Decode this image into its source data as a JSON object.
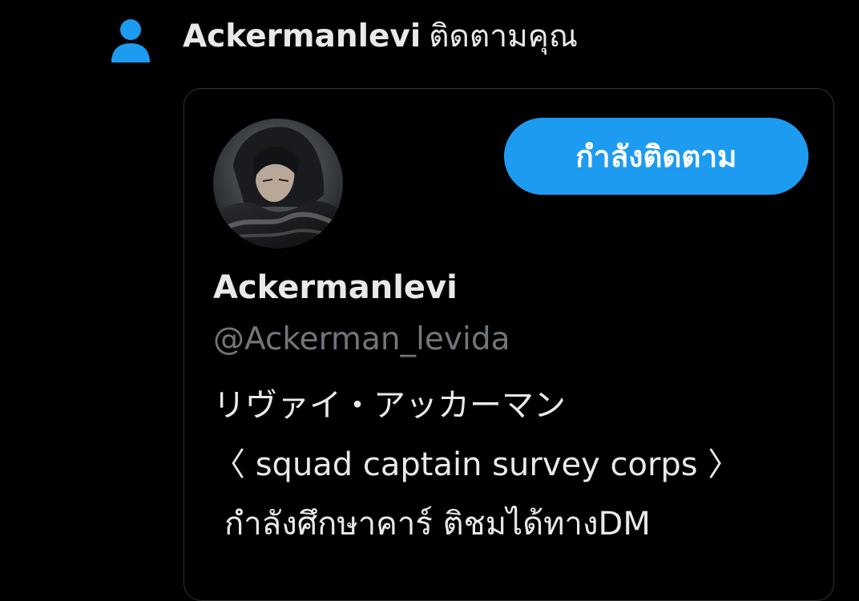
{
  "notification": {
    "icon": "person-icon",
    "name": "Ackermanlevi",
    "action": "ติดตามคุณ"
  },
  "card": {
    "avatar": "avatar",
    "follow_button": "กำลังติดตาม",
    "display_name": "Ackermanlevi",
    "handle": "@Ackerman_levida",
    "bio": [
      "リヴァイ・アッカーマン",
      "〈 squad captain survey corps 〉",
      "กำลังศึกษาคาร์ ติชมได้ทางDM"
    ]
  },
  "colors": {
    "background": "#000000",
    "accent": "#1d9bf0",
    "text": "#e7e9ea",
    "muted": "#71767b",
    "border": "#2f3336"
  }
}
